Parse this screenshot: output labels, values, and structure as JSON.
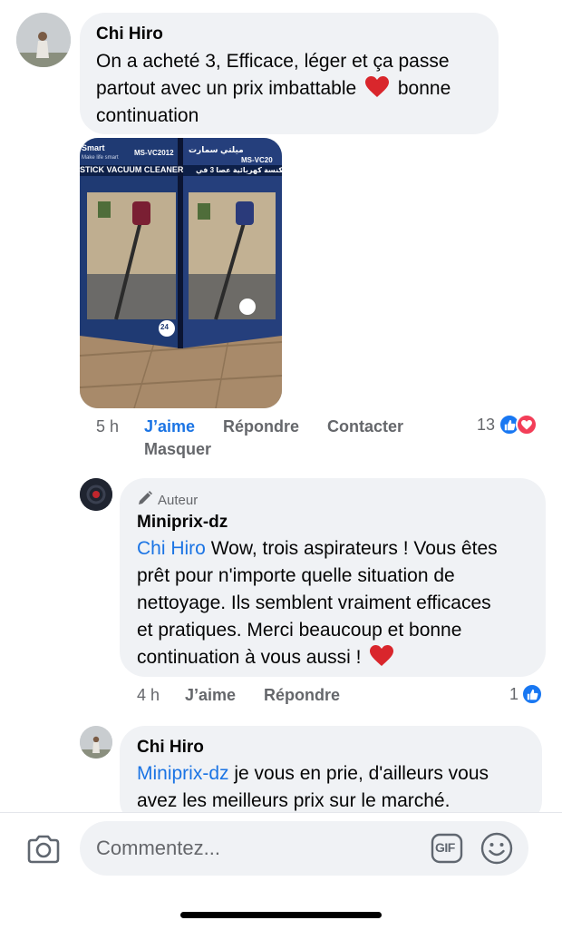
{
  "comments": [
    {
      "author": "Chi Hiro",
      "text": "On a acheté 3, Efficace, léger et ça passe partout avec un prix imbattable ❤️ bonne continuation",
      "line1": "On a acheté 3, Efficace, léger et ça passe",
      "line2_a": "partout avec un prix imbattable",
      "line2_b": "bonne",
      "line3": "continuation",
      "time": "5 h",
      "like_label": "J’aime",
      "reply_label": "Répondre",
      "contact_label": "Contacter",
      "hide_label": "Masquer",
      "reaction_count": "13",
      "photo": {
        "box_brand": "Smart",
        "box_slogan": "Make life smart",
        "box_model": "MS-VC2012",
        "box_title": "STICK VACUUM CLEANER",
        "box_model_2": "MS-VC20",
        "box_arabic_1": "ميلتي سمارت",
        "box_arabic_2": "مكنسة كهربائية عصا 3 في",
        "badge": "24"
      }
    },
    {
      "badge": "Auteur",
      "author": "Miniprix-dz",
      "mention": "Chi Hiro",
      "line1": "Wow, trois aspirateurs ! Vous êtes",
      "line2": "prêt pour n'importe quelle situation de",
      "line3": "nettoyage. Ils semblent vraiment efficaces",
      "line4": "et pratiques. Merci beaucoup et bonne",
      "line5": "continuation à vous aussi !",
      "time": "4 h",
      "like_label": "J’aime",
      "reply_label": "Répondre",
      "reaction_count": "1"
    },
    {
      "author": "Chi Hiro",
      "mention": "Miniprix-dz",
      "line1": "je vous en prie, d'ailleurs vous",
      "line2": "avez les meilleurs prix sur le marché."
    }
  ],
  "composer": {
    "placeholder": "Commentez...",
    "gif_label": "GIF"
  },
  "icons": [
    "heart-emoji-icon",
    "like-reaction-icon",
    "love-reaction-icon",
    "pencil-icon",
    "camera-icon",
    "gif-icon",
    "smiley-icon"
  ],
  "colors": {
    "accent": "#1b74e4",
    "bubble": "#f0f2f5",
    "meta": "#65676b",
    "love": "#f33e58",
    "like": "#1877f2"
  }
}
